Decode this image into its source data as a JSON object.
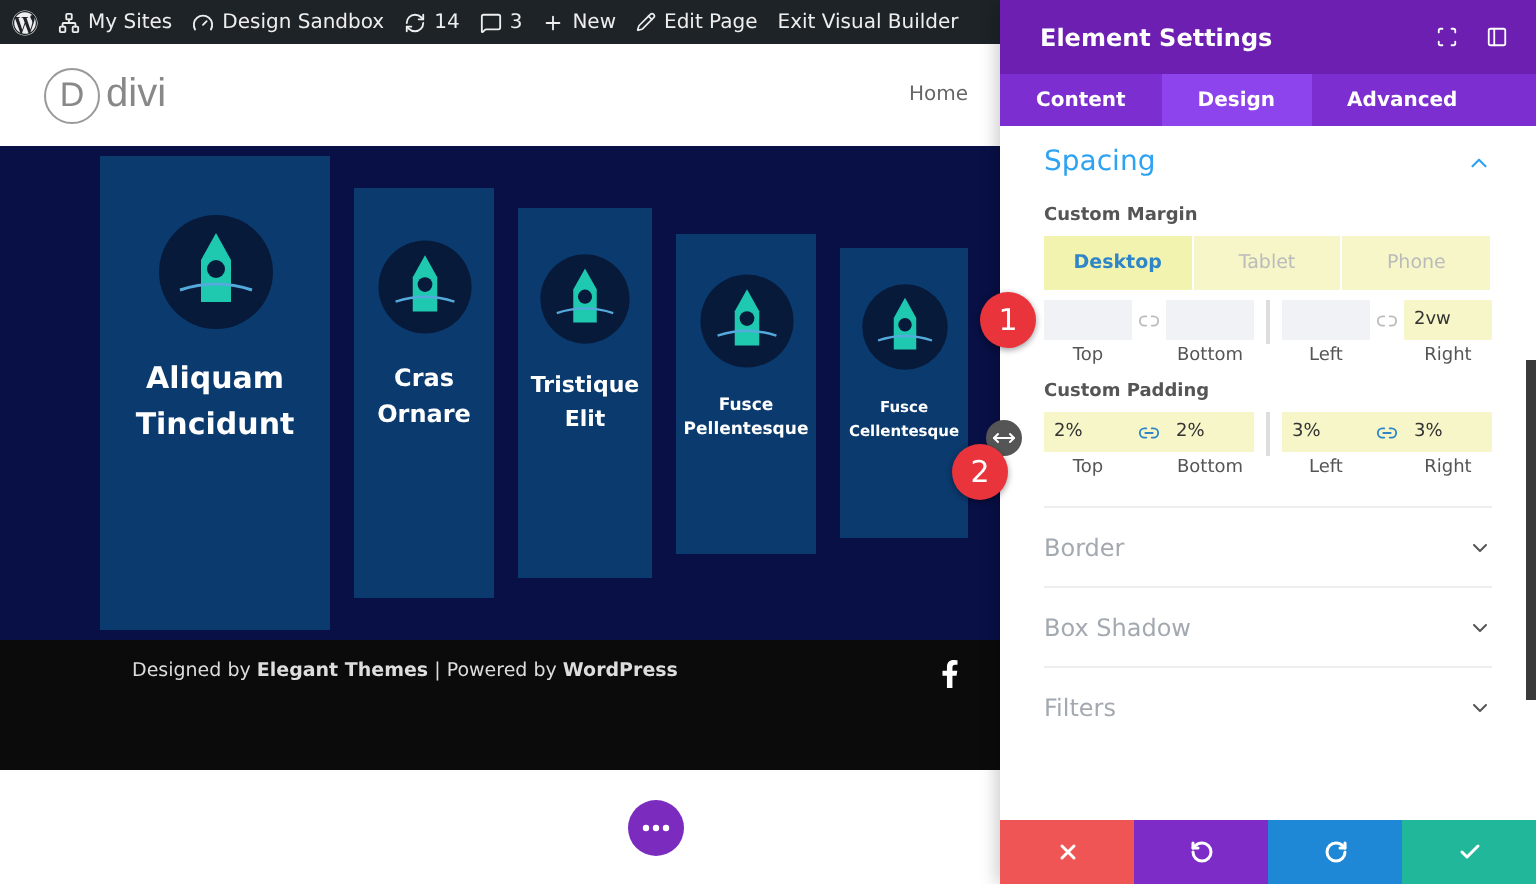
{
  "admin_bar": [
    {
      "kind": "wordpress"
    },
    {
      "kind": "sites",
      "label": "My Sites"
    },
    {
      "kind": "dashboard",
      "label": "Design Sandbox"
    },
    {
      "kind": "refresh",
      "label": "14"
    },
    {
      "kind": "comment",
      "label": "3"
    },
    {
      "kind": "plus",
      "label": "New"
    },
    {
      "kind": "pencil",
      "label": "Edit Page"
    },
    {
      "kind": "none",
      "label": "Exit Visual Builder"
    }
  ],
  "header": {
    "logo_letter": "D",
    "logo_text": "divi",
    "nav": [
      "Home"
    ]
  },
  "cards": [
    {
      "title": "Aliquam Tincidunt"
    },
    {
      "title": "Cras Ornare"
    },
    {
      "title": "Tristique Elit"
    },
    {
      "title": "Fusce Pellentesque"
    },
    {
      "title": "Fusce Cellentesque"
    }
  ],
  "footer": {
    "credit": "Designed by **Elegant Themes** | Powered by **WordPress**"
  },
  "panel": {
    "title": "Element Settings",
    "tabs": [
      {
        "label": "Content",
        "selected": false
      },
      {
        "label": "Design",
        "selected": true
      },
      {
        "label": "Advanced",
        "selected": false
      }
    ],
    "section": {
      "title": "Spacing",
      "expanded": true,
      "groups": [
        {
          "label": "Custom Margin",
          "devices": [
            {
              "label": "Desktop",
              "selected": true
            },
            {
              "label": "Tablet",
              "selected": false
            },
            {
              "label": "Phone",
              "selected": false
            }
          ],
          "pairs": [
            {
              "linked": false,
              "fields": [
                {
                  "label": "Top"
                },
                {
                  "label": "Bottom"
                }
              ]
            },
            {
              "linked": false,
              "fields": [
                {
                  "label": "Left"
                },
                {
                  "label": "Right",
                  "value": "2vw"
                }
              ]
            }
          ]
        },
        {
          "label": "Custom Padding",
          "pairs": [
            {
              "linked": true,
              "fields": [
                {
                  "label": "Top",
                  "value": "2%"
                },
                {
                  "label": "Bottom",
                  "value": "2%"
                }
              ]
            },
            {
              "linked": true,
              "fields": [
                {
                  "label": "Left",
                  "value": "3%"
                },
                {
                  "label": "Right",
                  "value": "3%"
                }
              ]
            }
          ]
        }
      ]
    },
    "collapsed": [
      {
        "title": "Border",
        "expanded": false
      },
      {
        "title": "Box Shadow",
        "expanded": false
      },
      {
        "title": "Filters",
        "expanded": false
      }
    ],
    "actions": [
      {
        "kind": "cancel"
      },
      {
        "kind": "undo"
      },
      {
        "kind": "redo"
      },
      {
        "kind": "save"
      }
    ]
  },
  "callouts": [
    "1",
    "2"
  ]
}
